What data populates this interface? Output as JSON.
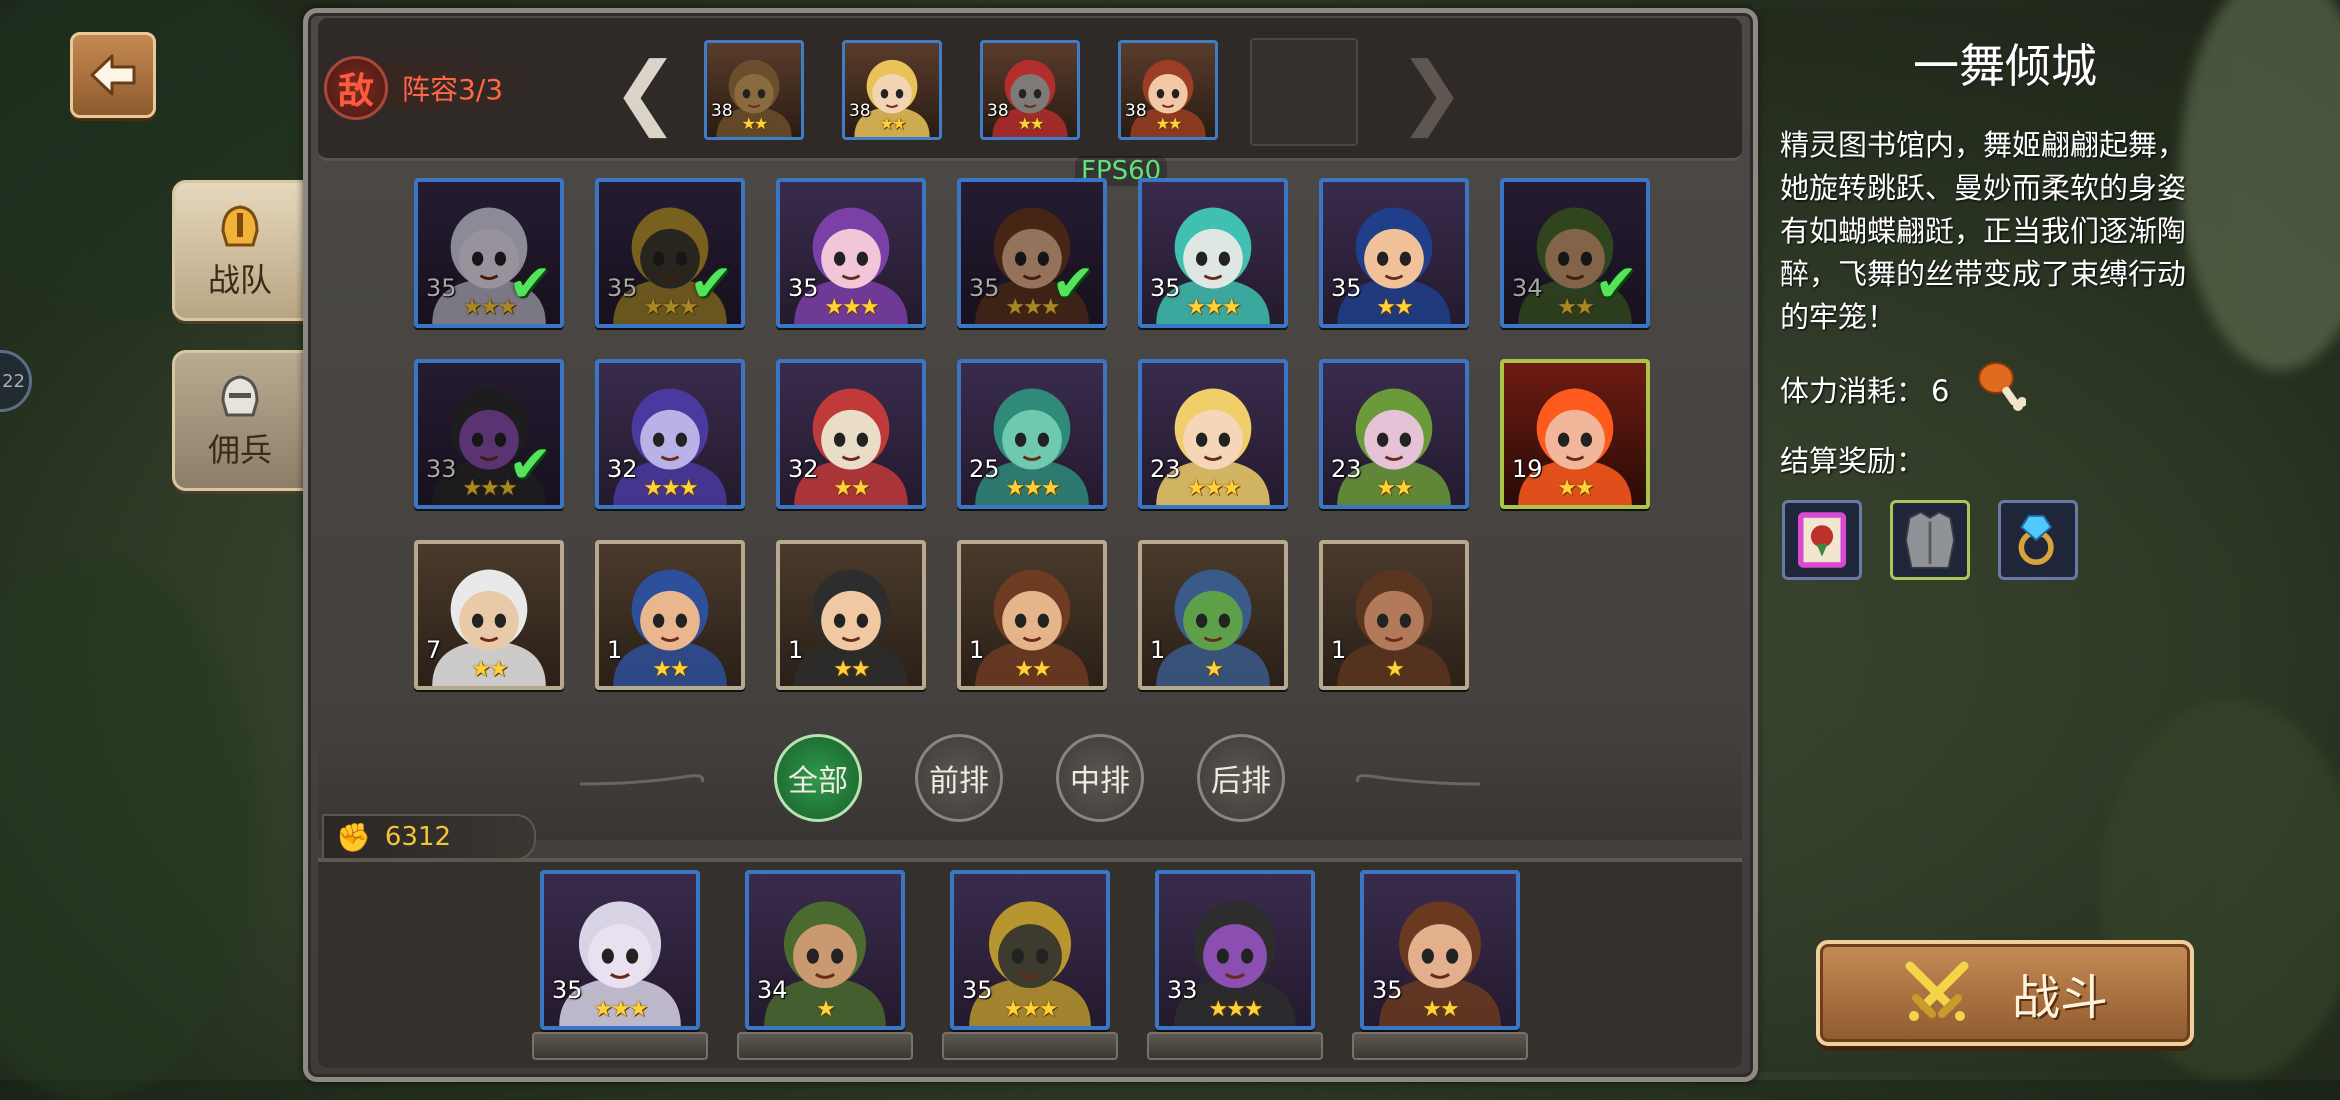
{
  "enemy": {
    "badge": "敌",
    "lineup": "阵容3/3",
    "units": [
      {
        "level": "38",
        "stars": 2,
        "skin": "#8a6b3f",
        "hair": "#6b4f2c"
      },
      {
        "level": "38",
        "stars": 2,
        "skin": "#f2d3b3",
        "hair": "#e9c35a"
      },
      {
        "level": "38",
        "stars": 2,
        "skin": "#7d7a78",
        "hair": "#b32d2d"
      },
      {
        "level": "38",
        "stars": 2,
        "skin": "#f1c9a5",
        "hair": "#9b3e24"
      }
    ]
  },
  "fps": "FPS60",
  "tabs": [
    {
      "label": "战队",
      "icon": "helmet-gold-icon"
    },
    {
      "label": "佣兵",
      "icon": "helmet-silver-icon"
    }
  ],
  "heroes": [
    {
      "level": "35",
      "stars": 3,
      "selected": true,
      "frame": "blue",
      "skin": "#e9e0f0",
      "hair": "#d8d4e6"
    },
    {
      "level": "35",
      "stars": 3,
      "selected": true,
      "frame": "blue",
      "skin": "#3d3a2e",
      "hair": "#b8962f"
    },
    {
      "level": "35",
      "stars": 3,
      "selected": false,
      "frame": "blue",
      "skin": "#f0c6d8",
      "hair": "#7b3fa8"
    },
    {
      "level": "35",
      "stars": 3,
      "selected": true,
      "frame": "blue",
      "skin": "#e3b08e",
      "hair": "#6a3a20"
    },
    {
      "level": "35",
      "stars": 3,
      "selected": false,
      "frame": "blue",
      "skin": "#dfe7e3",
      "hair": "#3fc0b0"
    },
    {
      "level": "35",
      "stars": 2,
      "selected": false,
      "frame": "blue",
      "skin": "#f1c29a",
      "hair": "#1f3f8a"
    },
    {
      "level": "34",
      "stars": 2,
      "selected": true,
      "frame": "blue",
      "skin": "#c99a70",
      "hair": "#4a6a2f"
    },
    {
      "level": "33",
      "stars": 3,
      "selected": true,
      "frame": "blue",
      "skin": "#8a4fb0",
      "hair": "#2d2d2d"
    },
    {
      "level": "32",
      "stars": 3,
      "selected": false,
      "frame": "blue",
      "skin": "#b8b2e6",
      "hair": "#4a3aa0"
    },
    {
      "level": "32",
      "stars": 2,
      "selected": false,
      "frame": "blue",
      "skin": "#e9ddc8",
      "hair": "#c13a3a"
    },
    {
      "level": "25",
      "stars": 3,
      "selected": false,
      "frame": "blue",
      "skin": "#6ec9b0",
      "hair": "#2f8a7a"
    },
    {
      "level": "23",
      "stars": 3,
      "selected": false,
      "frame": "blue",
      "skin": "#f6d6b8",
      "hair": "#f0cf6a"
    },
    {
      "level": "23",
      "stars": 2,
      "selected": false,
      "frame": "blue",
      "skin": "#e5c2d6",
      "hair": "#6a9a3a"
    },
    {
      "level": "19",
      "stars": 2,
      "selected": false,
      "frame": "green",
      "skin": "#f2b79a",
      "hair": "#ff5a1e"
    },
    {
      "level": "7",
      "stars": 2,
      "selected": false,
      "frame": "tan",
      "skin": "#e8c9a8",
      "hair": "#e9e9e9"
    },
    {
      "level": "1",
      "stars": 2,
      "selected": false,
      "frame": "tan",
      "skin": "#e9b68e",
      "hair": "#2e4f9b"
    },
    {
      "level": "1",
      "stars": 2,
      "selected": false,
      "frame": "tan",
      "skin": "#f0c9a2",
      "hair": "#2d2d2d"
    },
    {
      "level": "1",
      "stars": 2,
      "selected": false,
      "frame": "tan",
      "skin": "#e6b48a",
      "hair": "#6e3a22"
    },
    {
      "level": "1",
      "stars": 1,
      "selected": false,
      "frame": "tan",
      "skin": "#5ea04a",
      "hair": "#3a5a8a"
    },
    {
      "level": "1",
      "stars": 1,
      "selected": false,
      "frame": "tan",
      "skin": "#b27a5a",
      "hair": "#5a3520"
    }
  ],
  "filters": [
    "全部",
    "前排",
    "中排",
    "后排"
  ],
  "active_filter": 0,
  "power": "6312",
  "deployed": [
    {
      "level": "35",
      "stars": 3,
      "skin": "#e9e0f0",
      "hair": "#d8d4e6"
    },
    {
      "level": "34",
      "stars": 1,
      "skin": "#c99a70",
      "hair": "#4a6a2f"
    },
    {
      "level": "35",
      "stars": 3,
      "skin": "#3d3a2e",
      "hair": "#b8962f"
    },
    {
      "level": "33",
      "stars": 3,
      "skin": "#8a4fb0",
      "hair": "#2d2d2d"
    },
    {
      "level": "35",
      "stars": 2,
      "skin": "#e3b08e",
      "hair": "#6a3a20"
    }
  ],
  "stage": {
    "title": "一舞倾城",
    "description": "精灵图书馆内，舞姬翩翩起舞，她旋转跳跃、曼妙而柔软的身姿有如蝴蝶翩跹，正当我们逐渐陶醉，飞舞的丝带变成了束缚行动的牢笼！",
    "stamina_label": "体力消耗：",
    "stamina_value": "6",
    "reward_label": "结算奖励：",
    "rewards": [
      {
        "icon": "scroll-icon",
        "frame": "#6a7aa6"
      },
      {
        "icon": "armor-icon",
        "frame": "#a8c85a"
      },
      {
        "icon": "ring-icon",
        "frame": "#6a7aa6"
      }
    ]
  },
  "fight_label": "战斗",
  "colors": {
    "accent_green": "#54e35a",
    "enemy_red": "#ff6847",
    "power_gold": "#f3c33a",
    "star": "#ffd23a"
  }
}
